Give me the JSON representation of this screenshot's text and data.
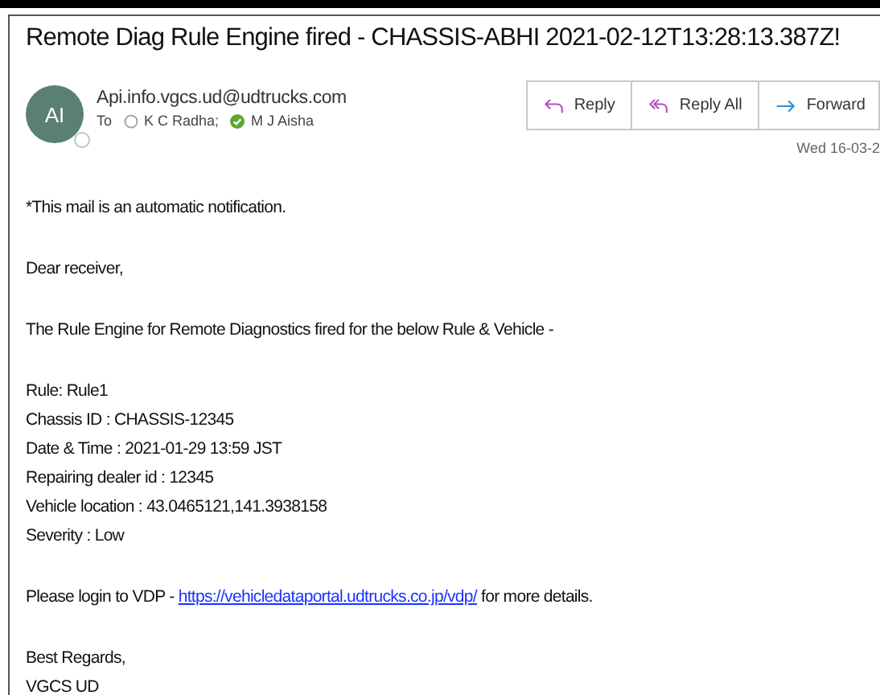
{
  "subject": "Remote Diag Rule Engine fired - CHASSIS-ABHI 2021-02-12T13:28:13.387Z!",
  "sender": {
    "initials": "AI",
    "address": "Api.info.vgcs.ud@udtrucks.com"
  },
  "to_label": "To",
  "recipients": [
    {
      "name": "K C Radha;",
      "available": false
    },
    {
      "name": "M J Aisha",
      "available": true
    }
  ],
  "actions": [
    {
      "label": "Reply",
      "kind": "reply"
    },
    {
      "label": "Reply All",
      "kind": "reply_all"
    },
    {
      "label": "Forward",
      "kind": "forward"
    }
  ],
  "date": "Wed 16-03-2",
  "body": [
    {
      "kind": "text",
      "lines": [
        "*This mail is an automatic notification."
      ]
    },
    {
      "kind": "text",
      "lines": [
        "Dear receiver,"
      ]
    },
    {
      "kind": "text",
      "lines": [
        "The Rule Engine for Remote Diagnostics fired for the below Rule & Vehicle -"
      ]
    },
    {
      "kind": "text",
      "lines": [
        "Rule: Rule1",
        "Chassis ID : CHASSIS-12345",
        "Date & Time : 2021-01-29 13:59 JST",
        "Repairing dealer id : 12345",
        "Vehicle location : 43.0465121,141.3938158",
        "Severity : Low"
      ]
    },
    {
      "kind": "link",
      "before": "Please login to VDP - ",
      "link": "https://vehicledataportal.udtrucks.co.jp/vdp/",
      "after": " for more details."
    },
    {
      "kind": "text",
      "lines": [
        "Best Regards,",
        "VGCS UD"
      ]
    }
  ]
}
